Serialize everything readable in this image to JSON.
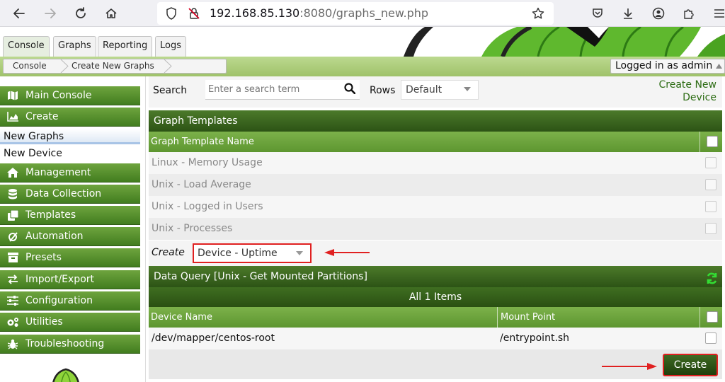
{
  "browser": {
    "url_host": "192.168.85.130",
    "url_rest": ":8080/graphs_new.php"
  },
  "tabs": [
    {
      "label": "Console",
      "active": true
    },
    {
      "label": "Graphs"
    },
    {
      "label": "Reporting"
    },
    {
      "label": "Logs"
    }
  ],
  "breadcrumb": [
    "Console",
    "Create New Graphs"
  ],
  "login": "Logged in as admin",
  "sidebar": {
    "items": [
      {
        "label": "Main Console",
        "icon": "map-icon"
      },
      {
        "label": "Create",
        "icon": "chart-area-icon"
      },
      {
        "label": "Management",
        "icon": "home-icon"
      },
      {
        "label": "Data Collection",
        "icon": "database-icon"
      },
      {
        "label": "Templates",
        "icon": "clone-icon"
      },
      {
        "label": "Automation",
        "icon": "automation-icon"
      },
      {
        "label": "Presets",
        "icon": "inbox-icon"
      },
      {
        "label": "Import/Export",
        "icon": "exchange-icon"
      },
      {
        "label": "Configuration",
        "icon": "sliders-icon"
      },
      {
        "label": "Utilities",
        "icon": "cogs-icon"
      },
      {
        "label": "Troubleshooting",
        "icon": "bug-icon"
      }
    ],
    "sub_items": [
      "New Graphs",
      "New Device"
    ]
  },
  "filter": {
    "search_label": "Search",
    "search_placeholder": "Enter a search term",
    "rows_label": "Rows",
    "rows_value": "Default",
    "create_new_device": "Create New Device"
  },
  "graph_templates": {
    "title": "Graph Templates",
    "column": "Graph Template Name",
    "rows": [
      "Linux - Memory Usage",
      "Unix - Load Average",
      "Unix - Logged in Users",
      "Unix - Processes"
    ],
    "create_label": "Create",
    "create_select": "Device - Uptime"
  },
  "data_query": {
    "title": "Data Query [Unix - Get Mounted Partitions]",
    "items_count": "All 1 Items",
    "columns": [
      "Device Name",
      "Mount Point"
    ],
    "rows": [
      {
        "device": "/dev/mapper/centos-root",
        "mount": "/entrypoint.sh"
      }
    ]
  },
  "create_button": "Create",
  "colors": {
    "accent_green": "#427d1f",
    "annotation_red": "#e02020"
  }
}
